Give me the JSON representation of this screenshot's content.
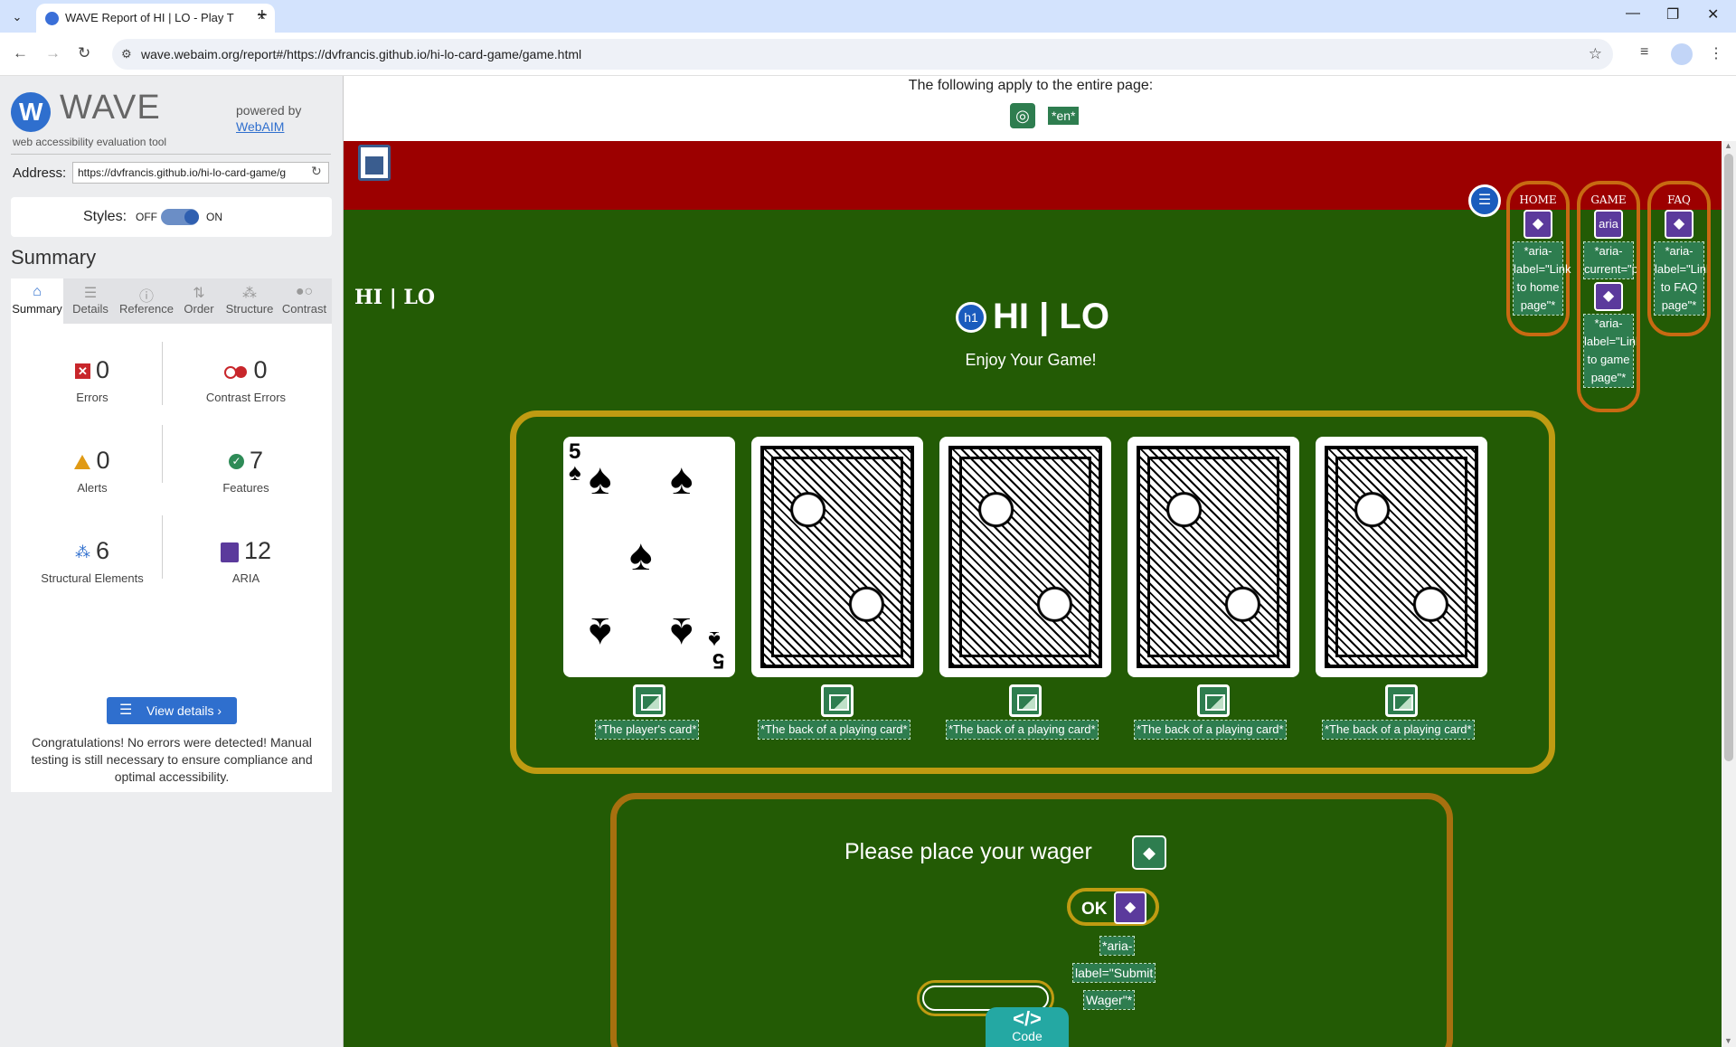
{
  "browser": {
    "tab_title": "WAVE Report of HI | LO - Play T",
    "url": "wave.webaim.org/report#/https://dvfrancis.github.io/hi-lo-card-game/game.html",
    "new_tab_symbol": "+",
    "close_symbol": "×",
    "minimize_symbol": "—",
    "restore_symbol": "❐",
    "window_close_symbol": "✕"
  },
  "wave": {
    "logo_letter": "W",
    "brand": "WAVE",
    "subtitle": "web accessibility evaluation tool",
    "powered_by": "powered by",
    "webaim": "WebAIM",
    "address_label": "Address:",
    "address_value": "https://dvfrancis.github.io/hi-lo-card-game/g",
    "styles_label": "Styles:",
    "styles_off": "OFF",
    "styles_on": "ON",
    "summary_heading": "Summary",
    "tabs": [
      {
        "label": "Summary",
        "icon": "home-icon"
      },
      {
        "label": "Details",
        "icon": "list-icon"
      },
      {
        "label": "Reference",
        "icon": "info-icon"
      },
      {
        "label": "Order",
        "icon": "order-icon"
      },
      {
        "label": "Structure",
        "icon": "structure-icon"
      },
      {
        "label": "Contrast",
        "icon": "contrast-icon"
      }
    ],
    "stats": {
      "errors": {
        "value": "0",
        "label": "Errors"
      },
      "contrast_errors": {
        "value": "0",
        "label": "Contrast Errors"
      },
      "alerts": {
        "value": "0",
        "label": "Alerts"
      },
      "features": {
        "value": "7",
        "label": "Features"
      },
      "structural": {
        "value": "6",
        "label": "Structural Elements"
      },
      "aria": {
        "value": "12",
        "label": "ARIA"
      }
    },
    "view_details": "View details ›",
    "congrats": "Congratulations! No errors were detected! Manual testing is still necessary to ensure compliance and optimal accessibility."
  },
  "page": {
    "apply_text": "The following apply to the entire page:",
    "lang_badge": "*en*",
    "brand": "HI | LO",
    "h1_badge": "h1",
    "title": "HI | LO",
    "subtitle": "Enjoy Your Game!",
    "nav": [
      {
        "title": "HOME",
        "tags": [
          {
            "type": "aria-label",
            "lines": [
              "*aria-",
              "label=\"Link",
              "to home",
              "page\"*"
            ]
          }
        ]
      },
      {
        "title": "GAME",
        "tags": [
          {
            "type": "aria-current",
            "icon_text": "aria",
            "lines": [
              "*aria-",
              "current=\"pa"
            ]
          },
          {
            "type": "aria-label",
            "lines": [
              "*aria-",
              "label=\"Link",
              "to game",
              "page\"*"
            ]
          }
        ]
      },
      {
        "title": "FAQ",
        "tags": [
          {
            "type": "aria-label",
            "lines": [
              "*aria-",
              "label=\"Link",
              "to FAQ",
              "page\"*"
            ]
          }
        ]
      }
    ],
    "cards": [
      {
        "kind": "face",
        "rank": "5",
        "suit": "♠",
        "alt": "*The player's card*"
      },
      {
        "kind": "back",
        "alt": "*The back of a playing card*"
      },
      {
        "kind": "back",
        "alt": "*The back of a playing card*"
      },
      {
        "kind": "back",
        "alt": "*The back of a playing card*"
      },
      {
        "kind": "back",
        "alt": "*The back of a playing card*"
      }
    ],
    "wager_text": "Please place your wager",
    "ok_label": "OK",
    "ok_aria": [
      "*aria-",
      "label=\"Submit",
      "Wager\"*"
    ],
    "code_icon": "</>",
    "code_label": "Code"
  },
  "colors": {
    "header_red": "#9c0000",
    "felt_green": "#235b05",
    "wave_blue": "#2f6fce",
    "feature_green": "#2e7d4f",
    "aria_purple": "#5b3a9c",
    "gold_border": "#bf9b12"
  }
}
